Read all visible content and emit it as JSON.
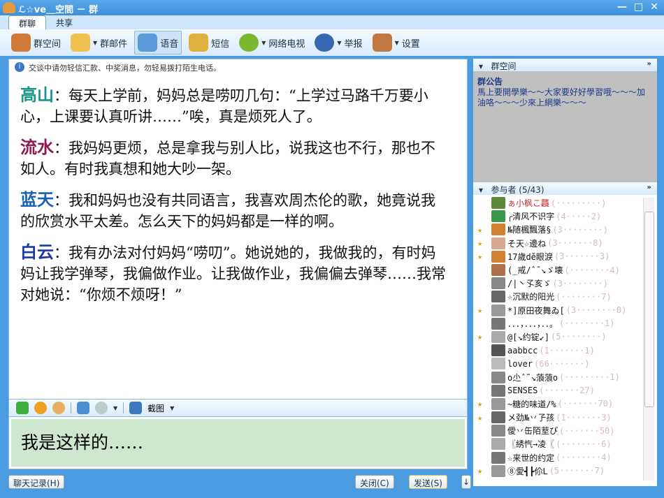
{
  "window": {
    "title": "ℒ☆ve＿空間 － 群",
    "minimize": "—",
    "maximize": "□",
    "close": "✕"
  },
  "tabs": [
    {
      "label": "群聊"
    },
    {
      "label": "共享"
    }
  ],
  "toolbar": [
    {
      "label": "群空间",
      "icon": "group-space-icon"
    },
    {
      "label": "群邮件",
      "icon": "mail-icon"
    },
    {
      "label": "语音",
      "icon": "voice-icon"
    },
    {
      "label": "短信",
      "icon": "sms-icon"
    },
    {
      "label": "网络电视",
      "icon": "tv-icon"
    },
    {
      "label": "举报",
      "icon": "police-icon"
    },
    {
      "label": "设置",
      "icon": "settings-icon"
    }
  ],
  "notice": "交谈中请勿轻信汇款、中奖消息，勿轻易拨打陌生电话。",
  "messages": [
    {
      "name": "高山",
      "text": "：每天上学前，妈妈总是唠叨几句：“上学过马路千万要小心，上课要认真听讲……”唉，真是烦死人了。",
      "color": "#18948a"
    },
    {
      "name": "流水",
      "text": "：我妈妈更烦，总是拿我与别人比，说我这也不行，那也不如人。有时我真想和她大吵一架。",
      "color": "#8a1a50"
    },
    {
      "name": "蓝天",
      "text": "：我和妈妈也没有共同语言，我喜欢周杰伦的歌，她竟说我的欣赏水平太差。怎么天下的妈妈都是一样的啊。",
      "color": "#1860b8"
    },
    {
      "name": "白云",
      "text": "：我有办法对付妈妈“唠叨”。她说她的，我做我的，有时妈妈让我学弹琴，我偏做作业。让我做作业，我偏偏去弹琴……我常对她说：“你烦不烦呀！”",
      "color": "#1a3aa8"
    }
  ],
  "format_bar": {
    "screenshot_label": "截图"
  },
  "input": {
    "value": "我是这样的……"
  },
  "buttons": {
    "history": "聊天记录(H)",
    "close": "关闭(C)",
    "send": "发送(S)",
    "send_options": "↓"
  },
  "group_space": {
    "header": "群空间",
    "more": "»",
    "announcement_title": "群公告",
    "announcement": "馬上要開學樂～～大家要好好學習哦～～～加油咯～～～少來上網樂～～～"
  },
  "participants": {
    "header": "参与者 (5/43)",
    "more": "»",
    "members": [
      {
        "name": "ぁ小枫こ龘",
        "qq": "(·········)",
        "admin": false
      },
      {
        "name": "╭清风不识字",
        "qq": "(4·····2)",
        "admin": false
      },
      {
        "name": "№随楓飄落§",
        "qq": "(3········)",
        "admin": true
      },
      {
        "name": "そ天☆邊ね",
        "qq": "(3·······8)",
        "admin": true
      },
      {
        "name": "17歲dě眼淚",
        "qq": "(3·······3)",
        "admin": true
      },
      {
        "name": "(_戒/ˆ˜↘ゞ壊",
        "qq": "(········4)",
        "admin": false
      },
      {
        "name": "/|丶孓亥ゞ",
        "qq": "(3········)",
        "admin": false
      },
      {
        "name": "☆沉默的阳光",
        "qq": "(········7)",
        "admin": false
      },
      {
        "name": "*]原田夜舞ゐ[",
        "qq": "(3········0)",
        "admin": true
      },
      {
        "name": "．．．，．．．，．．。",
        "qq": "(········1)",
        "admin": false
      },
      {
        "name": "@[↘约锭↙]",
        "qq": "(5········)",
        "admin": true
      },
      {
        "name": "aabbcc",
        "qq": "(1·······1)",
        "admin": false
      },
      {
        "name": "lover",
        "qq": "(66·······)",
        "admin": false
      },
      {
        "name": "o尐ˆ˜↘蒗蒗o",
        "qq": "(·········1)",
        "admin": false
      },
      {
        "name": "SENSES",
        "qq": "(·······27)",
        "admin": false
      },
      {
        "name": "~糖的味道/%",
        "qq": "(·······70)",
        "admin": true
      },
      {
        "name": "メ劲№丷孒孩",
        "qq": "(1·······3)",
        "admin": true
      },
      {
        "name": "僾丷缶陌荎ぴ",
        "qq": "(·······50)",
        "admin": false
      },
      {
        "name": "〖綉忾→凌〖",
        "qq": "(········6)",
        "admin": false
      },
      {
        "name": "☆来世的约定",
        "qq": "(········4)",
        "admin": false
      },
      {
        "name": "⑧愛┫┣伱L",
        "qq": "(5·······7)",
        "admin": true
      }
    ]
  }
}
